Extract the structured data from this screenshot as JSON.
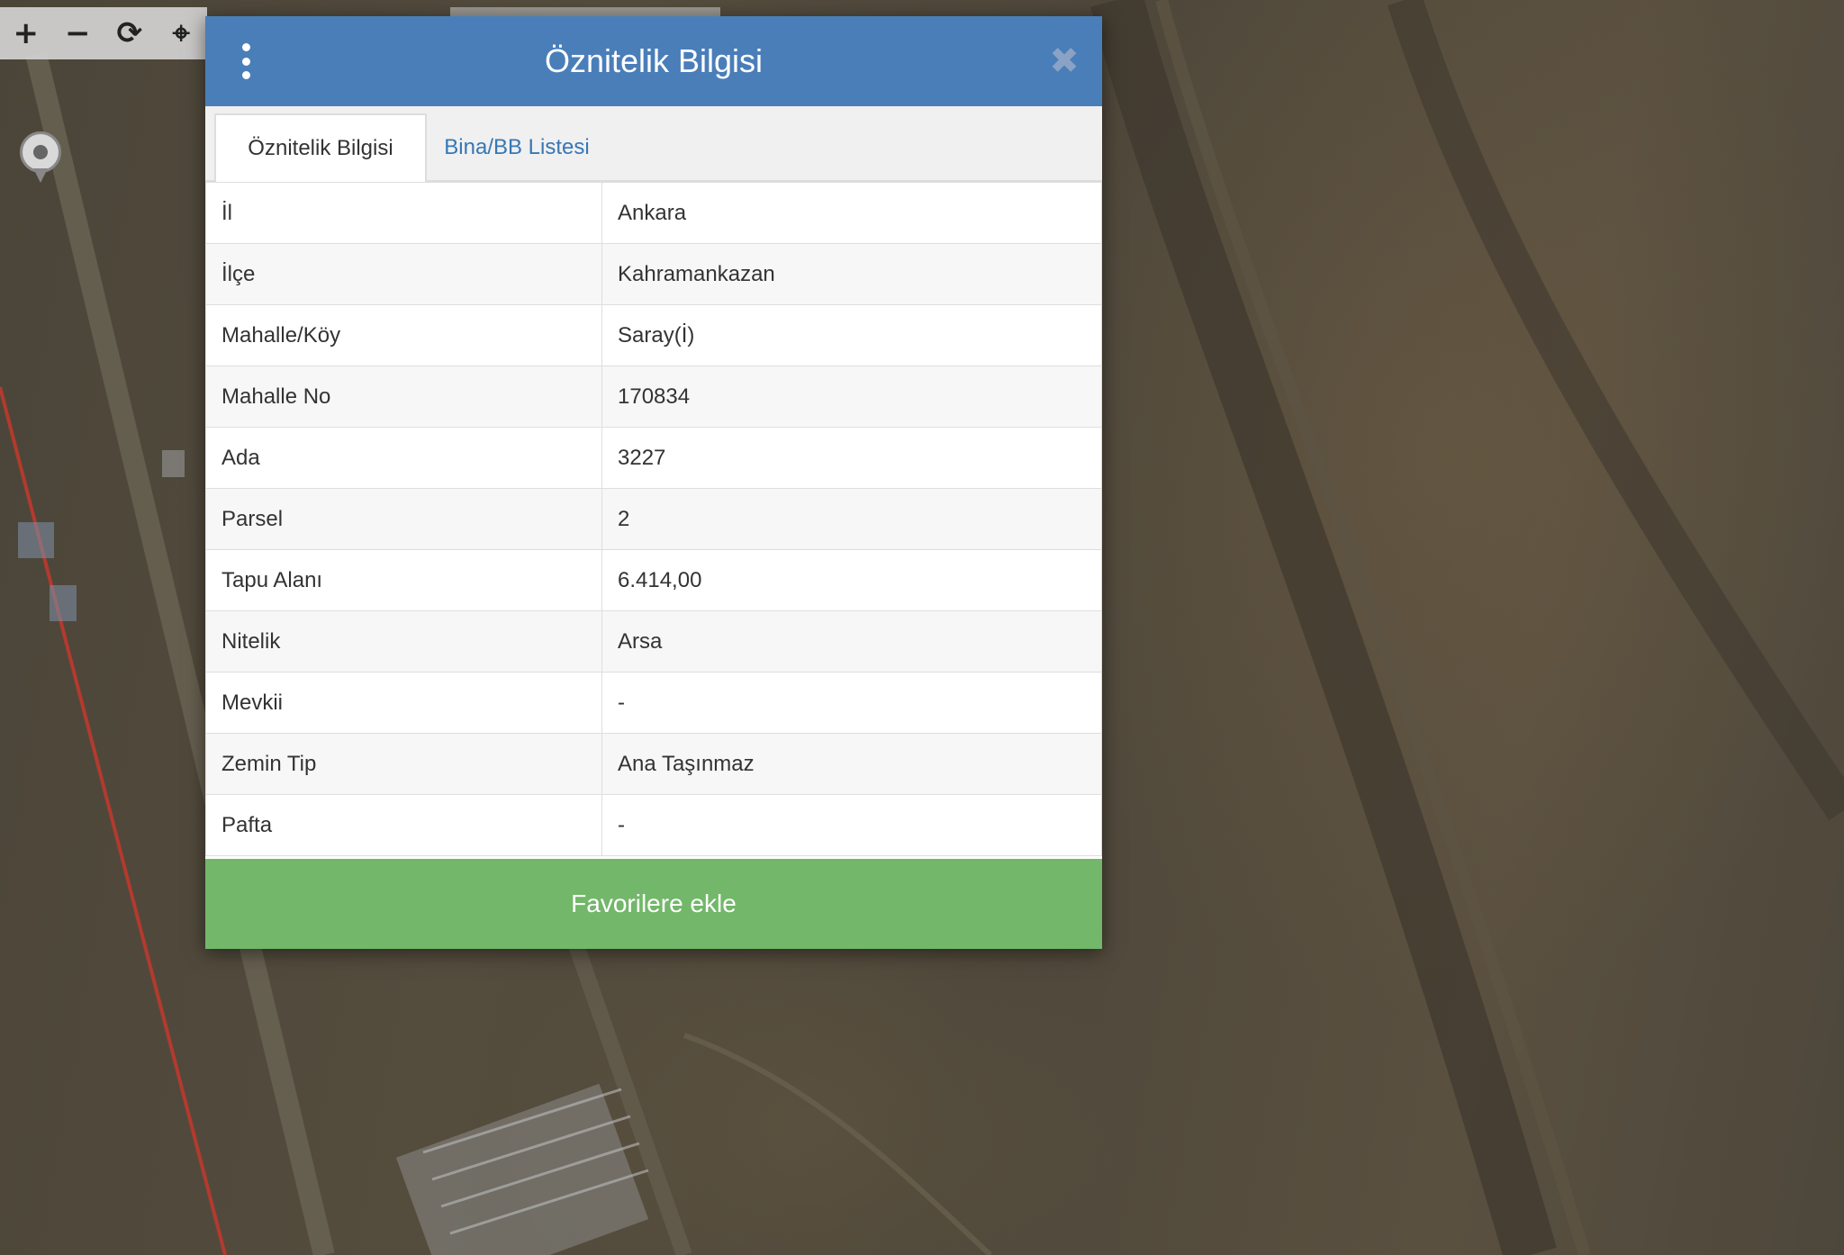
{
  "map": {
    "toolbar": [
      {
        "name": "zoom-in",
        "glyph": "+"
      },
      {
        "name": "zoom-out",
        "glyph": "−"
      },
      {
        "name": "refresh",
        "glyph": "⟳"
      },
      {
        "name": "locate",
        "glyph": "⌖"
      }
    ],
    "road_color": "#b33a2e"
  },
  "dialog": {
    "title": "Öznitelik Bilgisi",
    "close_glyph": "✖",
    "header_color": "#4a7eb9",
    "tabs": [
      {
        "label": "Öznitelik Bilgisi",
        "active": true
      },
      {
        "label": "Bina/BB Listesi",
        "active": false
      }
    ],
    "rows": [
      {
        "label": "İl",
        "value": "Ankara"
      },
      {
        "label": "İlçe",
        "value": "Kahramankazan"
      },
      {
        "label": "Mahalle/Köy",
        "value": "Saray(İ)"
      },
      {
        "label": "Mahalle No",
        "value": "170834"
      },
      {
        "label": "Ada",
        "value": "3227"
      },
      {
        "label": "Parsel",
        "value": "2"
      },
      {
        "label": "Tapu Alanı",
        "value": "6.414,00"
      },
      {
        "label": "Nitelik",
        "value": "Arsa"
      },
      {
        "label": "Mevkii",
        "value": "-"
      },
      {
        "label": "Zemin Tip",
        "value": "Ana Taşınmaz"
      },
      {
        "label": "Pafta",
        "value": "-"
      }
    ],
    "favorite_button": "Favorilere ekle",
    "favorite_color": "#72b76a"
  }
}
